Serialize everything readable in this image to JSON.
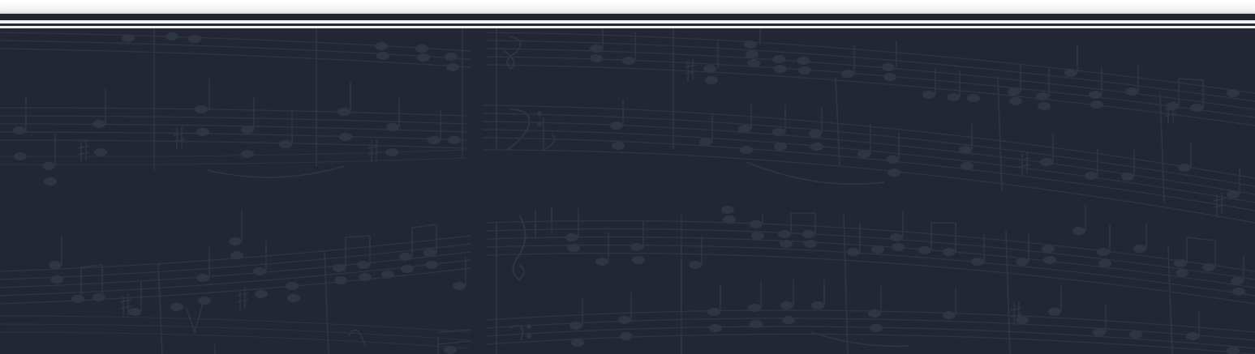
{
  "header": {
    "rule_color": "#23262f",
    "top_background": "#ffffff"
  },
  "hero": {
    "background_color": "#222733",
    "pattern_color": "#2f3542",
    "pattern_icon": "sheet-music-pattern"
  }
}
